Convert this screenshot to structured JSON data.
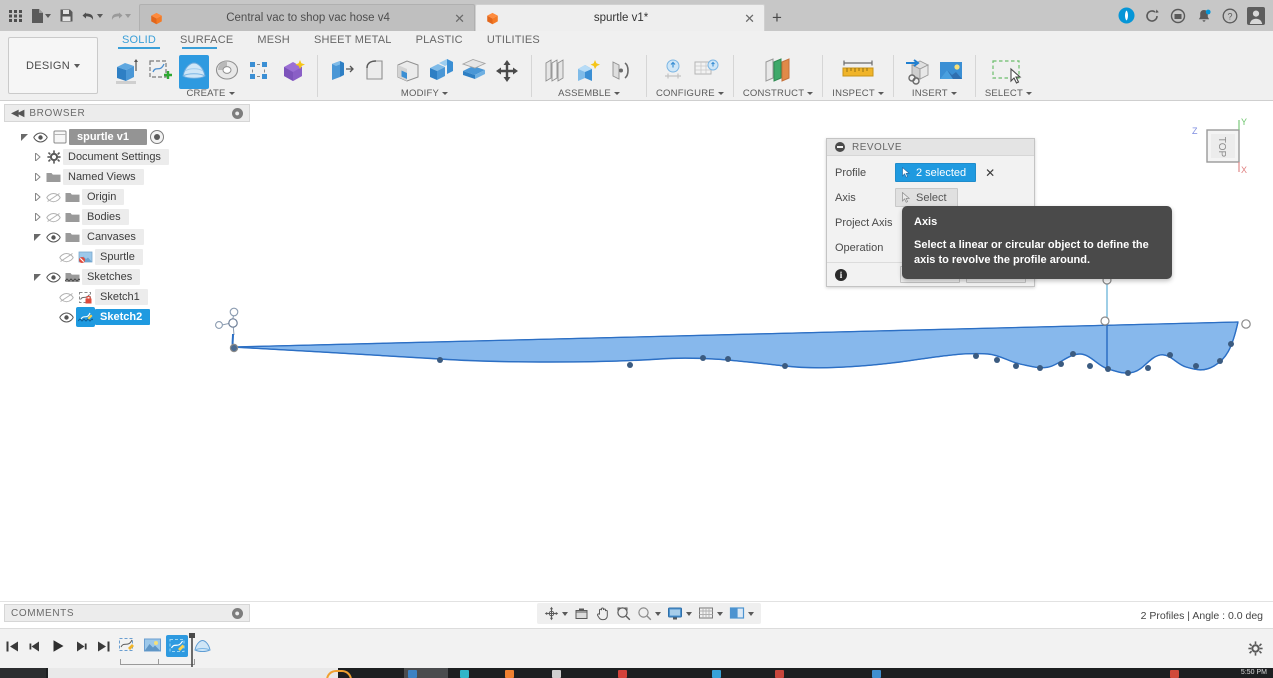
{
  "titlebar": {
    "quick_access": [
      {
        "name": "app-grid-icon",
        "label": "Apps"
      },
      {
        "name": "new-file-icon",
        "label": "New"
      },
      {
        "name": "save-icon",
        "label": "Save"
      },
      {
        "name": "undo-icon",
        "label": "Undo"
      },
      {
        "name": "redo-icon",
        "label": "Redo"
      }
    ],
    "tabs": [
      {
        "label": "Central vac to shop vac hose v4",
        "active": false,
        "close": "✕"
      },
      {
        "label": "spurtle v1*",
        "active": true,
        "close": "✕"
      }
    ],
    "new_tab_label": "+",
    "right_icons": [
      {
        "name": "extensions-icon",
        "label": "Extensions"
      },
      {
        "name": "job-status-icon",
        "label": "Job Status"
      },
      {
        "name": "recent-icon",
        "label": "Recent"
      },
      {
        "name": "notifications-icon",
        "label": "Notifications"
      },
      {
        "name": "help-icon",
        "label": "Help"
      },
      {
        "name": "account-icon",
        "label": "Account"
      }
    ]
  },
  "ribbon": {
    "workspace": "DESIGN",
    "tabs": [
      {
        "label": "SOLID",
        "active": true
      },
      {
        "label": "SURFACE",
        "active": false
      },
      {
        "label": "MESH",
        "active": false
      },
      {
        "label": "SHEET METAL",
        "active": false
      },
      {
        "label": "PLASTIC",
        "active": false
      },
      {
        "label": "UTILITIES",
        "active": false
      }
    ],
    "groups": [
      {
        "name": "CREATE",
        "dropdown": true
      },
      {
        "name": "MODIFY",
        "dropdown": true
      },
      {
        "name": "ASSEMBLE",
        "dropdown": true
      },
      {
        "name": "CONFIGURE",
        "dropdown": true
      },
      {
        "name": "CONSTRUCT",
        "dropdown": true
      },
      {
        "name": "INSPECT",
        "dropdown": true
      },
      {
        "name": "INSERT",
        "dropdown": true
      },
      {
        "name": "SELECT",
        "dropdown": true
      }
    ]
  },
  "browser": {
    "title": "BROWSER",
    "items": [
      {
        "label": "spurtle v1",
        "depth": 0,
        "twisty": "down",
        "eye": "on",
        "icon": "component-icon",
        "root": true,
        "selected": false,
        "radio": true
      },
      {
        "label": "Document Settings",
        "depth": 1,
        "twisty": "right",
        "eye": "none",
        "icon": "gear-icon",
        "root": false,
        "selected": false
      },
      {
        "label": "Named Views",
        "depth": 1,
        "twisty": "right",
        "eye": "none",
        "icon": "folder-icon",
        "root": false,
        "selected": false
      },
      {
        "label": "Origin",
        "depth": 1,
        "twisty": "right",
        "eye": "off",
        "icon": "folder-icon",
        "root": false,
        "selected": false
      },
      {
        "label": "Bodies",
        "depth": 1,
        "twisty": "right",
        "eye": "off",
        "icon": "folder-icon",
        "root": false,
        "selected": false
      },
      {
        "label": "Canvases",
        "depth": 1,
        "twisty": "down",
        "eye": "on",
        "icon": "folder-icon",
        "root": false,
        "selected": false
      },
      {
        "label": "Spurtle",
        "depth": 2,
        "twisty": "none",
        "eye": "off",
        "icon": "canvas-icon",
        "root": false,
        "selected": false
      },
      {
        "label": "Sketches",
        "depth": 1,
        "twisty": "down",
        "eye": "on",
        "icon": "sketches-folder-icon",
        "root": false,
        "selected": false
      },
      {
        "label": "Sketch1",
        "depth": 2,
        "twisty": "none",
        "eye": "off",
        "icon": "sketch-icon",
        "root": false,
        "selected": false
      },
      {
        "label": "Sketch2",
        "depth": 2,
        "twisty": "none",
        "eye": "on",
        "icon": "sketch-icon",
        "root": false,
        "selected": true
      }
    ]
  },
  "dialog": {
    "title": "REVOLVE",
    "rows": [
      {
        "label": "Profile",
        "control": "selected",
        "value": "2 selected",
        "has_clear": true
      },
      {
        "label": "Axis",
        "control": "select",
        "value": "Select",
        "has_clear": false
      },
      {
        "label": "Project Axis",
        "control": "hidden",
        "value": "",
        "has_clear": false
      },
      {
        "label": "Operation",
        "control": "hidden",
        "value": "",
        "has_clear": false
      }
    ],
    "ok_label": "OK",
    "cancel_label": "Cancel",
    "info_label": "i"
  },
  "tooltip": {
    "title": "Axis",
    "body": "Select a linear or circular object to define the axis to revolve the profile around."
  },
  "viewcube": {
    "face": "TOP",
    "axes": {
      "z": "Z",
      "y": "Y",
      "x": "X"
    }
  },
  "navbar": {
    "items": [
      {
        "name": "orbit-icon",
        "dropdown": true
      },
      {
        "name": "look-at-icon",
        "dropdown": false
      },
      {
        "name": "pan-icon",
        "dropdown": false
      },
      {
        "name": "zoom-icon",
        "dropdown": false
      },
      {
        "name": "zoom-window-icon",
        "dropdown": true
      },
      {
        "name": "display-settings-icon",
        "dropdown": true
      },
      {
        "name": "grid-snaps-icon",
        "dropdown": true
      },
      {
        "name": "viewports-icon",
        "dropdown": true
      }
    ]
  },
  "status": {
    "text": "2 Profiles | Angle : 0.0 deg"
  },
  "comments": {
    "title": "COMMENTS"
  },
  "timeline": {
    "playback": [
      {
        "name": "go-to-beginning-icon"
      },
      {
        "name": "step-backward-icon"
      },
      {
        "name": "play-icon"
      },
      {
        "name": "step-forward-icon"
      },
      {
        "name": "go-to-end-icon"
      }
    ],
    "features": [
      {
        "name": "sketch-feature-icon",
        "selected": false
      },
      {
        "name": "canvas-feature-icon",
        "selected": false
      },
      {
        "name": "sketch2-feature-icon",
        "selected": true
      },
      {
        "name": "revolve-feature-icon",
        "selected": false
      }
    ],
    "settings_icon": "gear-icon"
  },
  "taskbar": {
    "time": "5:50 PM"
  },
  "sketch": {
    "profile_fill": "#6ca8e8",
    "profile_stroke": "#2c6fc4",
    "construction_line_color": "#69b4d8",
    "point_color": "#3b5b80",
    "open_point_stroke": "#8a8a8a"
  }
}
